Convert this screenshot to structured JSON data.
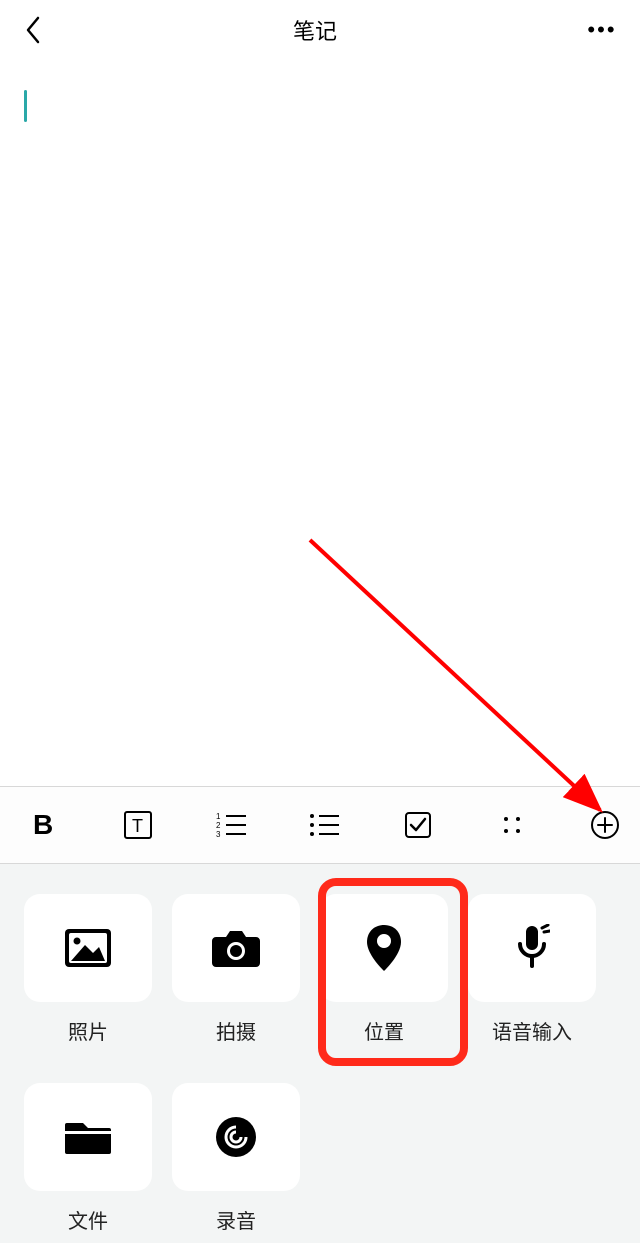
{
  "header": {
    "title": "笔记"
  },
  "toolbar": {
    "bold": "B",
    "text_style": "T",
    "numbered_list": "numbered-list",
    "bullet_list": "bullet-list",
    "checkbox": "checkbox",
    "divider_dots": "divider",
    "add": "+"
  },
  "panel": {
    "items": [
      {
        "key": "photo",
        "label": "照片"
      },
      {
        "key": "camera",
        "label": "拍摄"
      },
      {
        "key": "location",
        "label": "位置"
      },
      {
        "key": "voice",
        "label": "语音输入"
      },
      {
        "key": "file",
        "label": "文件"
      },
      {
        "key": "record",
        "label": "录音"
      }
    ]
  },
  "annotation": {
    "arrow_color": "#ff0000",
    "highlight_target": "location"
  }
}
